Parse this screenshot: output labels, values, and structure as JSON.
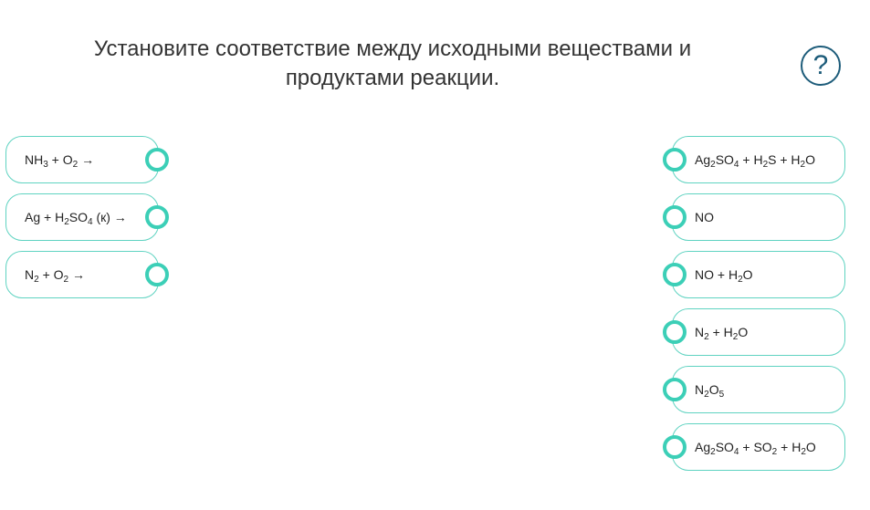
{
  "title": {
    "line1": "Установите соответствие между исходными веществами и",
    "line2": "продуктами реакции."
  },
  "help": {
    "label": "?",
    "icon": "question-mark-icon"
  },
  "colors": {
    "accent": "#3ccfb7",
    "border": "#5fd3c1",
    "help": "#1d5c7a"
  },
  "left_items": [
    {
      "parts": [
        [
          "NH",
          ""
        ],
        [
          "3",
          "sub"
        ],
        [
          " + O",
          ""
        ],
        [
          "2",
          "sub"
        ],
        [
          " →",
          ""
        ]
      ]
    },
    {
      "parts": [
        [
          "Ag + H",
          ""
        ],
        [
          "2",
          "sub"
        ],
        [
          "SO",
          ""
        ],
        [
          "4",
          "sub"
        ],
        [
          " (к) →",
          ""
        ]
      ]
    },
    {
      "parts": [
        [
          "N",
          ""
        ],
        [
          "2",
          "sub"
        ],
        [
          " + O",
          ""
        ],
        [
          "2",
          "sub"
        ],
        [
          " →",
          ""
        ]
      ]
    }
  ],
  "right_items": [
    {
      "parts": [
        [
          "Ag",
          ""
        ],
        [
          "2",
          "sub"
        ],
        [
          "SO",
          ""
        ],
        [
          "4",
          "sub"
        ],
        [
          " + H",
          ""
        ],
        [
          "2",
          "sub"
        ],
        [
          "S + H",
          ""
        ],
        [
          "2",
          "sub"
        ],
        [
          "O",
          ""
        ]
      ]
    },
    {
      "parts": [
        [
          "NO",
          ""
        ]
      ]
    },
    {
      "parts": [
        [
          "NO + H",
          ""
        ],
        [
          "2",
          "sub"
        ],
        [
          "O",
          ""
        ]
      ]
    },
    {
      "parts": [
        [
          "N",
          ""
        ],
        [
          "2",
          "sub"
        ],
        [
          " + H",
          ""
        ],
        [
          "2",
          "sub"
        ],
        [
          "O",
          ""
        ]
      ]
    },
    {
      "parts": [
        [
          "N",
          ""
        ],
        [
          "2",
          "sub"
        ],
        [
          "O",
          ""
        ],
        [
          "5",
          "sub"
        ]
      ]
    },
    {
      "parts": [
        [
          "Ag",
          ""
        ],
        [
          "2",
          "sub"
        ],
        [
          "SO",
          ""
        ],
        [
          "4",
          "sub"
        ],
        [
          " + SO",
          ""
        ],
        [
          "2",
          "sub"
        ],
        [
          " + H",
          ""
        ],
        [
          "2",
          "sub"
        ],
        [
          "O",
          ""
        ]
      ]
    }
  ]
}
